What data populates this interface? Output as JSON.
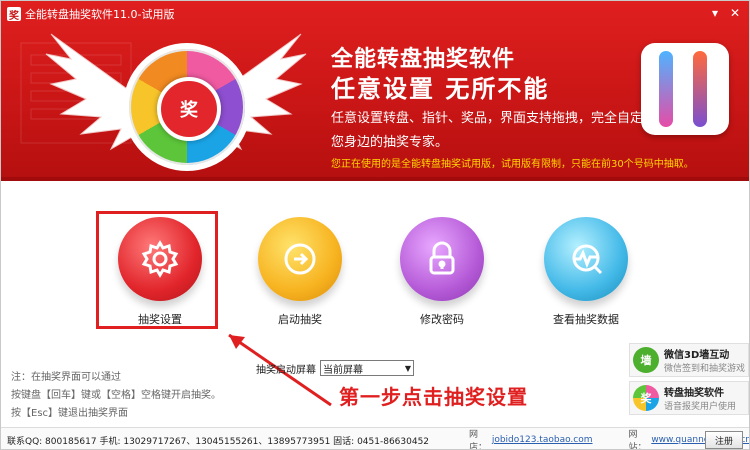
{
  "window": {
    "title": "全能转盘抽奖软件11.0-试用版",
    "minimize_glyph": "▾",
    "close_glyph": "✕",
    "logo_glyph": "奖"
  },
  "banner": {
    "brand_name": "全能转盘抽奖软件",
    "slogan": "任意设置  无所不能",
    "desc_line1": "任意设置转盘、指针、奖品，界面支持拖拽，完全自定义。",
    "desc_line2": "您身边的抽奖专家。",
    "trial_notice": "您正在使用的是全能转盘抽奖试用版，试用版有限制，只能在前30个号码中抽取。",
    "wheel_hub_text": "奖"
  },
  "features": [
    {
      "label": "抽奖设置",
      "icon": "gear-icon"
    },
    {
      "label": "启动抽奖",
      "icon": "start-arrow-icon"
    },
    {
      "label": "修改密码",
      "icon": "lock-icon"
    },
    {
      "label": "查看抽奖数据",
      "icon": "chart-search-icon"
    }
  ],
  "screen_setting": {
    "label": "抽奖启动屏幕",
    "selected": "当前屏幕"
  },
  "notes": [
    "注：在抽奖界面可以通过",
    "按键盘【回车】键或【空格】空格键开启抽奖。",
    "按【Esc】键退出抽奖界面"
  ],
  "annotation": {
    "text": "第一步点击抽奖设置",
    "color": "#e02020"
  },
  "side_cards": [
    {
      "title": "微信3D墙互动",
      "subtitle": "微信签到和抽奖游戏",
      "icon": "wechat-wall-icon",
      "glyph": "墙"
    },
    {
      "title": "转盘抽奖软件",
      "subtitle": "语音报奖用户使用",
      "icon": "wheel-icon",
      "glyph": "奖"
    }
  ],
  "footer": {
    "contacts": "联系QQ: 800185617   手机: 13029717267、13045155261、13895773951   固话: 0451-86630452",
    "shop_label": "网店：",
    "shop_link": "jobido123.taobao.com",
    "site_label": "网站：",
    "site_link": "www.quannengsoft.cn",
    "register_label": "注册"
  },
  "colors": {
    "banner_red": "#d01818",
    "trial_yellow": "#ffd700",
    "feature1": "#e1252b",
    "feature2": "#f7b320",
    "feature3": "#b65bd8",
    "feature4": "#43b9e8"
  }
}
